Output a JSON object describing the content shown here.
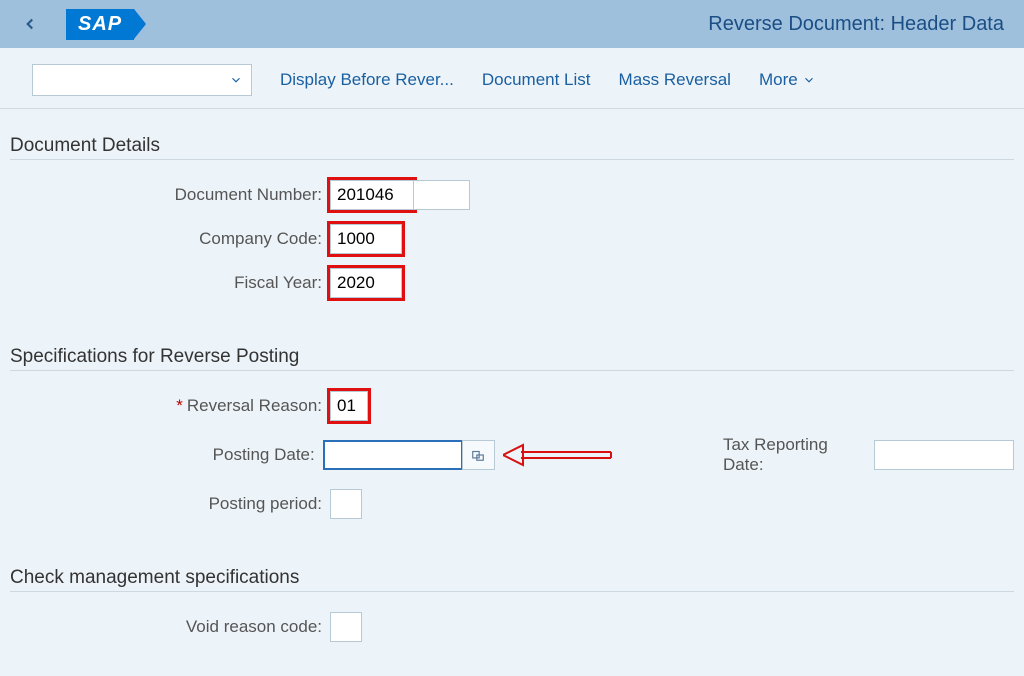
{
  "header": {
    "logo_text": "SAP",
    "page_title": "Reverse Document: Header Data"
  },
  "toolbar": {
    "display_before": "Display Before Rever...",
    "document_list": "Document List",
    "mass_reversal": "Mass Reversal",
    "more": "More"
  },
  "sections": {
    "document_details": "Document Details",
    "reverse_posting": "Specifications for Reverse Posting",
    "check_mgmt": "Check management specifications"
  },
  "labels": {
    "document_number": "Document Number:",
    "company_code": "Company Code:",
    "fiscal_year": "Fiscal Year:",
    "reversal_reason": "Reversal Reason:",
    "posting_date": "Posting Date:",
    "posting_period": "Posting period:",
    "tax_reporting_date": "Tax Reporting Date:",
    "void_reason_code": "Void reason code:"
  },
  "values": {
    "document_number": "201046",
    "company_code": "1000",
    "fiscal_year": "2020",
    "reversal_reason": "01",
    "posting_date": "",
    "posting_period": "",
    "tax_reporting_date": "",
    "void_reason_code": ""
  }
}
